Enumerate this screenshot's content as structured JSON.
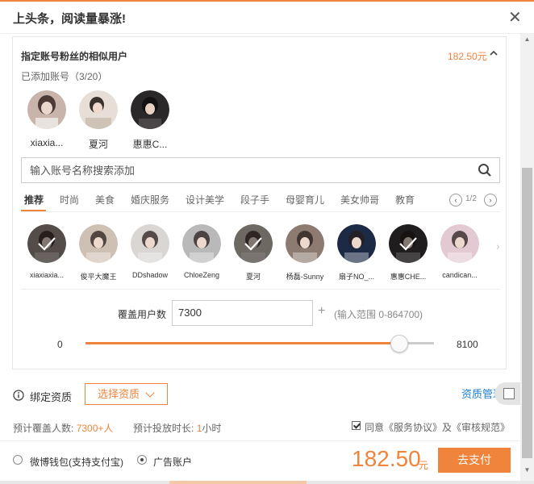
{
  "dialog": {
    "title": "上头条，阅读量暴涨!",
    "close_glyph": "✕"
  },
  "panel": {
    "title": "指定账号粉丝的相似用户",
    "price": "182.50元",
    "caret": "^",
    "added_label": "已添加账号（3/20）",
    "added_accounts": [
      {
        "name": "xiaxia...",
        "color": "#b49a92"
      },
      {
        "name": "夏河",
        "color": "#d8cfc7"
      },
      {
        "name": "惠惠C...",
        "color": "#2e2b2c"
      }
    ]
  },
  "search": {
    "placeholder": "输入账号名称搜索添加",
    "value": ""
  },
  "tabs": [
    "推荐",
    "时尚",
    "美食",
    "婚庆服务",
    "设计美学",
    "段子手",
    "母婴育儿",
    "美女帅哥",
    "教育"
  ],
  "pager": {
    "prev": "‹",
    "next": "›",
    "text": "1/2"
  },
  "recommendations": [
    {
      "name": "xiaxiaxia...",
      "selected": true,
      "color": "#9a8a86"
    },
    {
      "name": "俊平大魔王",
      "selected": false,
      "color": "#cfc0b4"
    },
    {
      "name": "DDshadow",
      "selected": false,
      "color": "#d9d6d4"
    },
    {
      "name": "ChloeZeng",
      "selected": false,
      "color": "#b9b9b9"
    },
    {
      "name": "夏河",
      "selected": true,
      "color": "#c9bdb4"
    },
    {
      "name": "杨磊-Sunny",
      "selected": false,
      "color": "#8d7b72"
    },
    {
      "name": "扇子NO_...",
      "selected": false,
      "color": "#1d2a45"
    },
    {
      "name": "惠惠CHE...",
      "selected": true,
      "color": "#3a3536"
    },
    {
      "name": "candican...",
      "selected": false,
      "color": "#e3c9d2"
    }
  ],
  "rec_next": "›",
  "coverage": {
    "label": "覆盖用户数",
    "value": "7300",
    "plus": "+",
    "range_hint": "(输入范围 0-864700)"
  },
  "slider": {
    "min_label": "0",
    "max_label": "8100",
    "fraction": 0.9
  },
  "resource": {
    "bind_label": "绑定资质",
    "select_label": "选择资质",
    "manage_label": "资质管理"
  },
  "estimate": {
    "reach_label": "预计覆盖人数:",
    "reach_value": "7300",
    "reach_suffix": "+人",
    "duration_label": "预计投放时长:",
    "duration_value": "1",
    "duration_unit": "小时"
  },
  "agreement": {
    "checked": true,
    "text": "同意《服务协议》及《审核规范》"
  },
  "payment": {
    "options": [
      {
        "label": "微博钱包(支持支付宝)",
        "selected": false
      },
      {
        "label": "广告账户",
        "selected": true
      }
    ],
    "total": "182.50",
    "unit": "元",
    "pay_label": "去支付"
  },
  "colors": {
    "accent": "#f0843c",
    "link": "#1a7fd4"
  }
}
